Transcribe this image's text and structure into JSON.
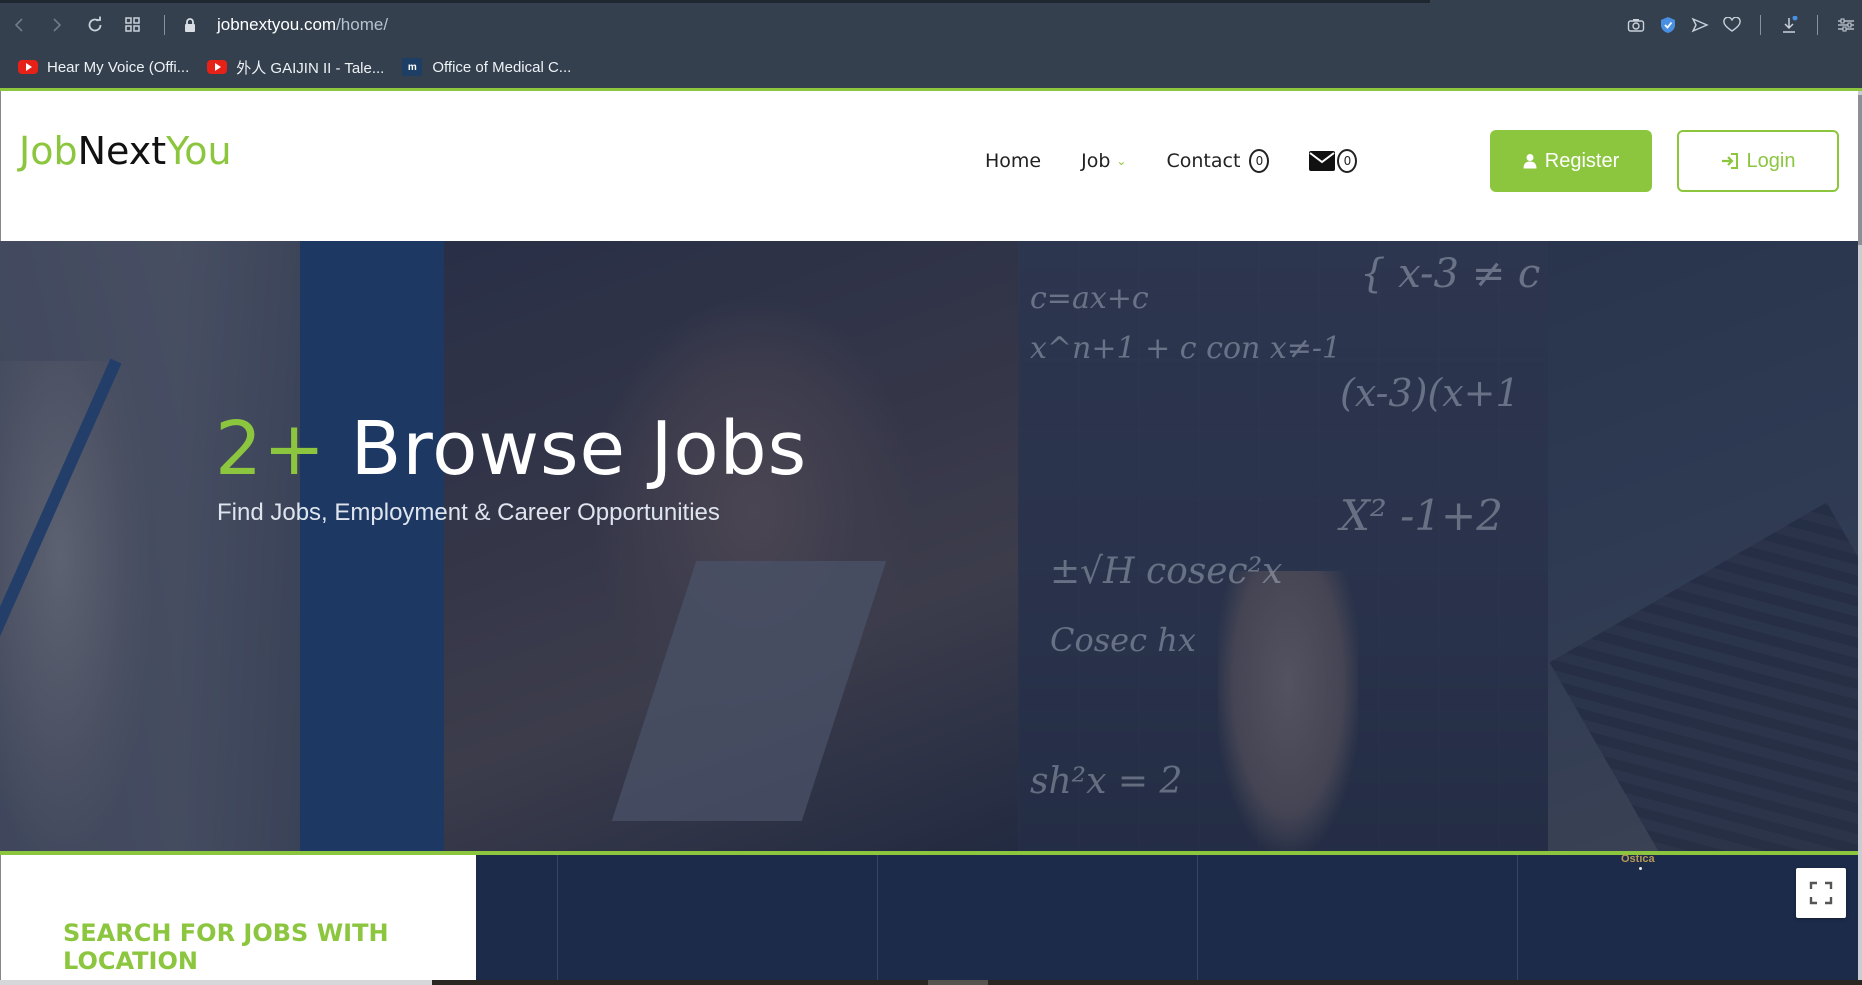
{
  "browser": {
    "url_domain": "jobnextyou.com",
    "url_path": "/home/",
    "bookmarks": [
      {
        "label": "Hear My Voice (Offi...",
        "icon": "youtube-icon"
      },
      {
        "label": "外人 GAIJIN II - Tale...",
        "icon": "youtube-icon"
      },
      {
        "label": "Office of Medical C...",
        "icon": "mm-site-icon"
      }
    ],
    "mm_icon_text": "m"
  },
  "header": {
    "logo": {
      "part1": "Job",
      "part2": "Next",
      "part3": "You"
    },
    "nav": {
      "home": "Home",
      "job": "Job",
      "contact": "Contact",
      "contact_count": "0",
      "mail_count": "0"
    },
    "register_label": "Register",
    "login_label": "Login"
  },
  "hero": {
    "count": "2+",
    "title": " Browse Jobs",
    "subtitle": "Find Jobs, Employment & Career Opportunities"
  },
  "search": {
    "title": "SEARCH FOR JOBS WITH LOCATION"
  },
  "map": {
    "place_label": "Ostica"
  },
  "colors": {
    "brand_green": "#8cc63f",
    "chrome_bg": "#34404e",
    "map_bg": "#1c2b4a"
  }
}
